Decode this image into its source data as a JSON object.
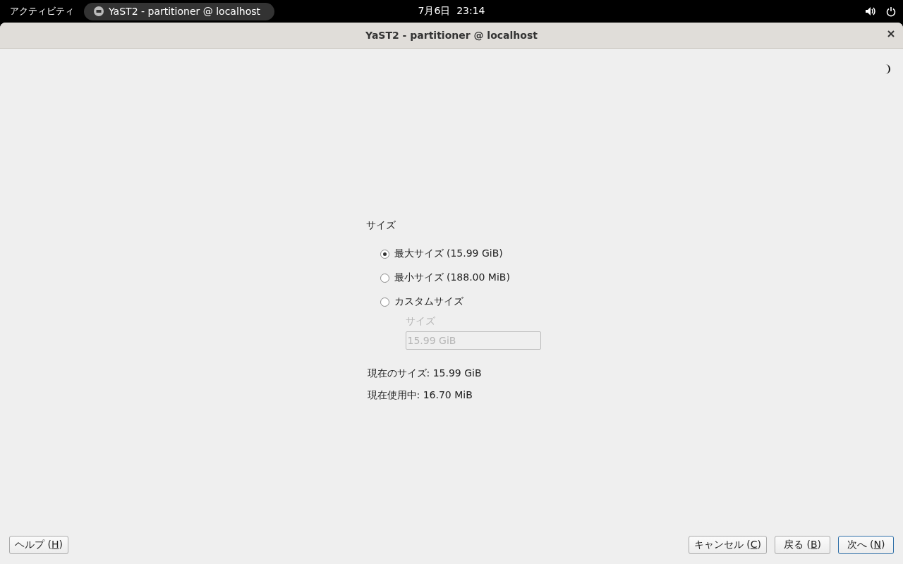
{
  "top_bar": {
    "activities": "アクティビティ",
    "app_title": "YaST2 - partitioner @ localhost",
    "clock": "7月6日  23:14"
  },
  "window": {
    "title": "YaST2 - partitioner @ localhost"
  },
  "size_group": {
    "label": "サイズ",
    "options": [
      {
        "label": "最大サイズ (15.99 GiB)",
        "selected": true
      },
      {
        "label": "最小サイズ (188.00 MiB)",
        "selected": false
      },
      {
        "label": "カスタムサイズ",
        "selected": false
      }
    ],
    "custom_field": {
      "label": "サイズ",
      "value": "15.99 GiB",
      "disabled": true
    }
  },
  "info": [
    "現在のサイズ: 15.99 GiB",
    "現在使用中: 16.70 MiB"
  ],
  "buttons": [
    {
      "kind": "left",
      "before": "ヘルプ (",
      "mnemonic": "H",
      "after": ")",
      "default": false
    },
    {
      "kind": "right",
      "before": "キャンセル (",
      "mnemonic": "C",
      "after": ")",
      "default": false
    },
    {
      "kind": "right",
      "before": "戻る (",
      "mnemonic": "B",
      "after": ")",
      "default": false
    },
    {
      "kind": "right",
      "before": "次へ (",
      "mnemonic": "N",
      "after": ")",
      "default": true
    }
  ]
}
